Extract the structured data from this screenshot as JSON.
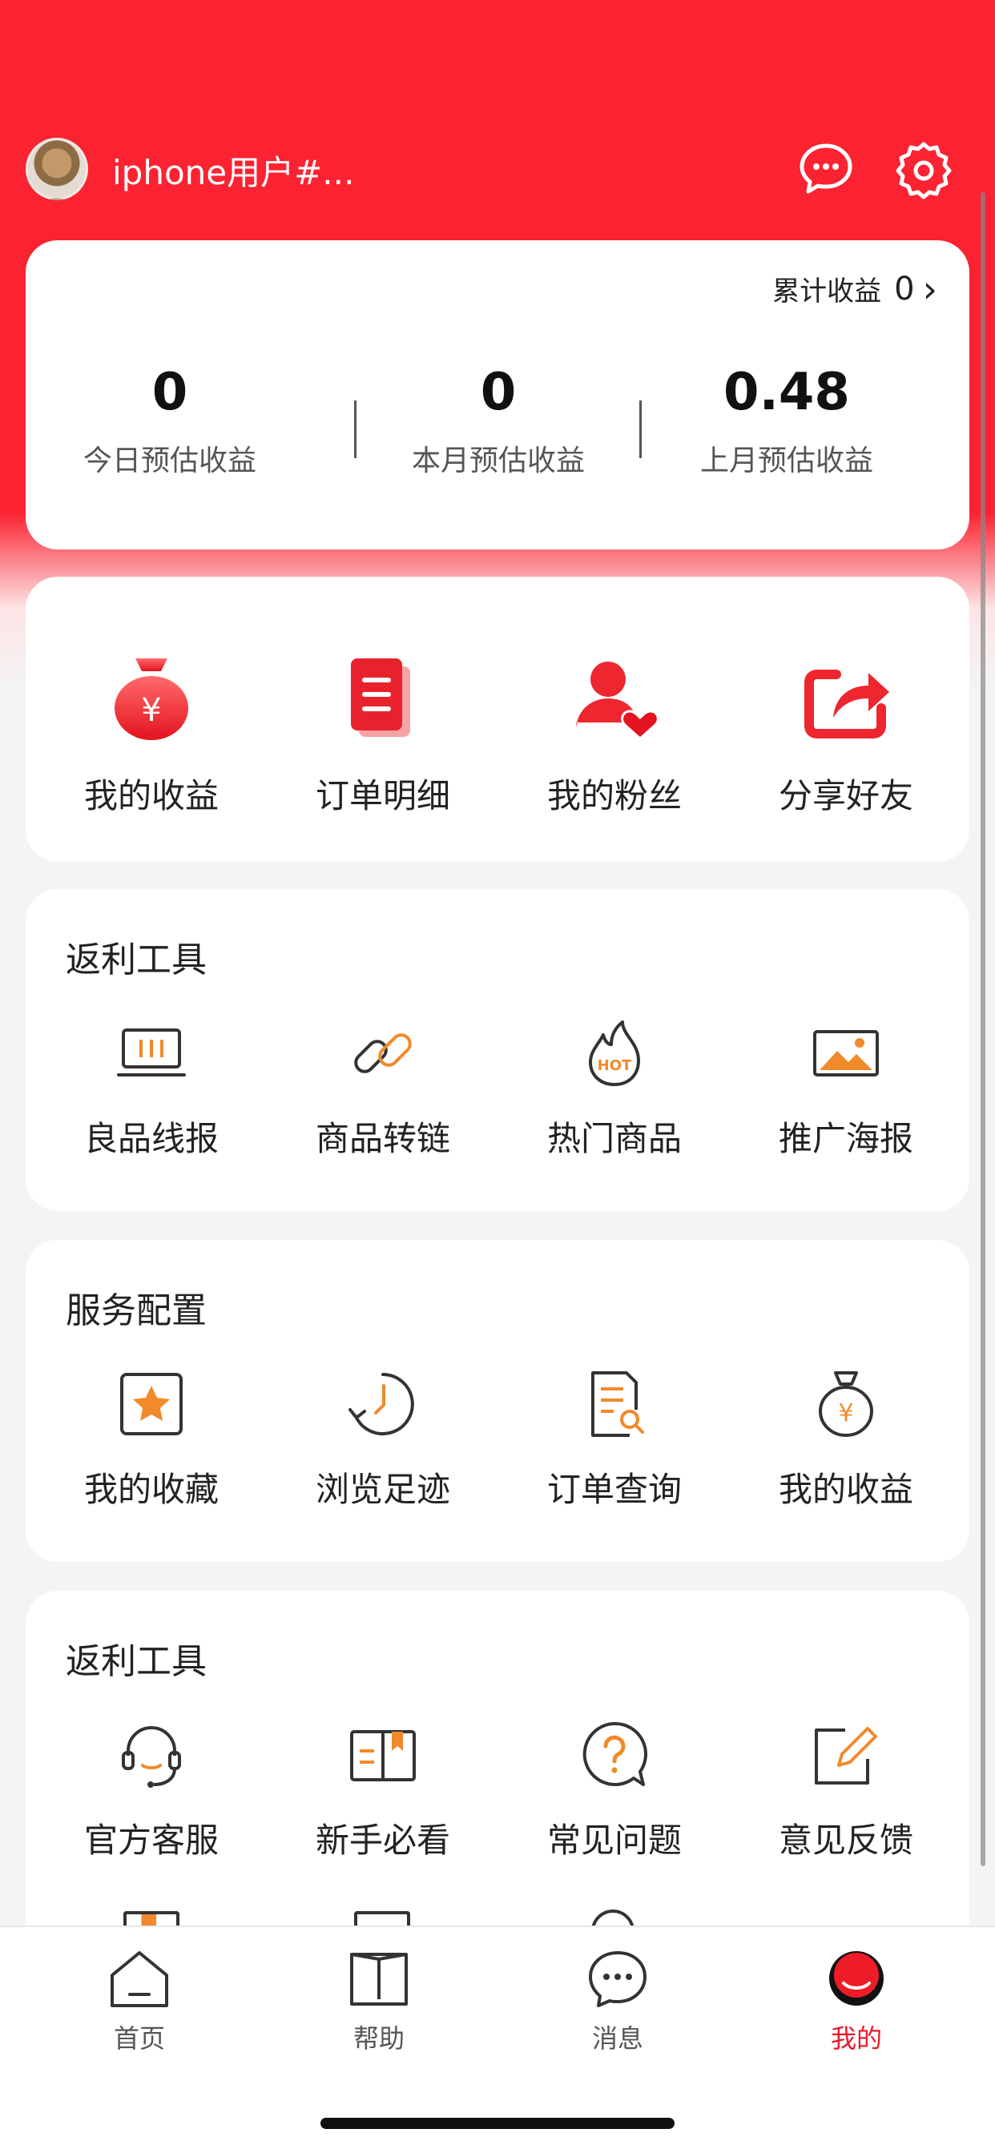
{
  "header": {
    "username": "iphone用户#...",
    "message_icon": "chat-bubble-icon",
    "settings_icon": "gear-icon"
  },
  "earnings": {
    "total_label": "累计收益",
    "total_value": "0",
    "stats": [
      {
        "value": "0",
        "label": "今日预估收益"
      },
      {
        "value": "0",
        "label": "本月预估收益"
      },
      {
        "value": "0.48",
        "label": "上月预估收益"
      }
    ]
  },
  "quick_actions": [
    {
      "label": "我的收益",
      "icon": "money-bag-icon"
    },
    {
      "label": "订单明细",
      "icon": "clipboard-icon"
    },
    {
      "label": "我的粉丝",
      "icon": "user-heart-icon"
    },
    {
      "label": "分享好友",
      "icon": "share-icon"
    }
  ],
  "section1": {
    "title": "返利工具",
    "items": [
      {
        "label": "良品线报",
        "icon": "monitor-icon"
      },
      {
        "label": "商品转链",
        "icon": "link-icon"
      },
      {
        "label": "热门商品",
        "icon": "hot-flame-icon"
      },
      {
        "label": "推广海报",
        "icon": "picture-icon"
      }
    ]
  },
  "section2": {
    "title": "服务配置",
    "items": [
      {
        "label": "我的收藏",
        "icon": "star-box-icon"
      },
      {
        "label": "浏览足迹",
        "icon": "history-icon"
      },
      {
        "label": "订单查询",
        "icon": "document-search-icon"
      },
      {
        "label": "我的收益",
        "icon": "money-bag-outline-icon"
      }
    ]
  },
  "section3": {
    "title": "返利工具",
    "items": [
      {
        "label": "官方客服",
        "icon": "headset-icon"
      },
      {
        "label": "新手必看",
        "icon": "book-icon"
      },
      {
        "label": "常见问题",
        "icon": "question-bubble-icon"
      },
      {
        "label": "意见反馈",
        "icon": "edit-icon"
      }
    ]
  },
  "tabbar": {
    "tabs": [
      {
        "label": "首页",
        "icon": "home-icon"
      },
      {
        "label": "帮助",
        "icon": "book-tab-icon"
      },
      {
        "label": "消息",
        "icon": "message-tab-icon"
      },
      {
        "label": "我的",
        "icon": "profile-tab-icon"
      }
    ],
    "active": "我的"
  },
  "colors": {
    "brand_red": "#fb2331",
    "accent_orange": "#f08a2a",
    "active_tab": "#e81a28"
  }
}
